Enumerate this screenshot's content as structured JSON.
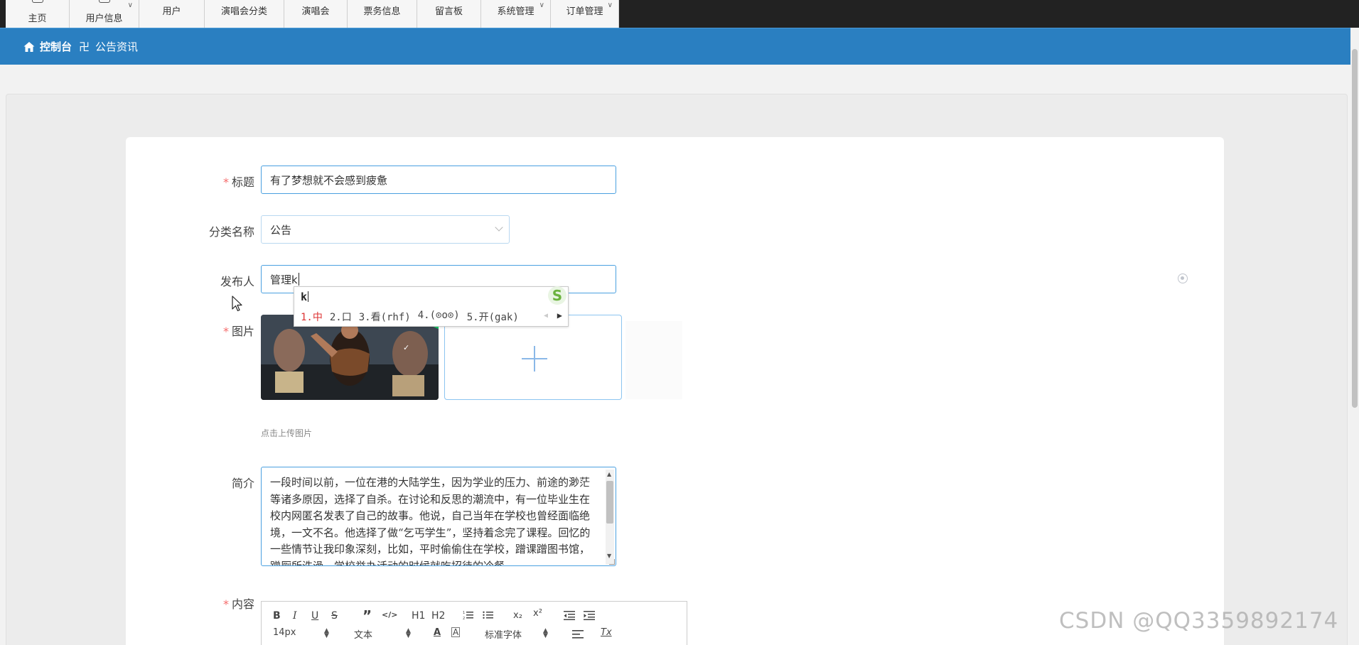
{
  "nav": {
    "tabs": [
      {
        "label": "主页"
      },
      {
        "label": "用户信息"
      },
      {
        "label": "用户"
      },
      {
        "label": "演唱会分类"
      },
      {
        "label": "演唱会"
      },
      {
        "label": "票务信息"
      },
      {
        "label": "留言板"
      },
      {
        "label": "系统管理"
      },
      {
        "label": "订单管理"
      }
    ]
  },
  "breadcrumb": {
    "home": "控制台",
    "separator": "卍",
    "current": "公告资讯"
  },
  "form": {
    "title_label": "标题",
    "title_value": "有了梦想就不会感到疲惫",
    "category_label": "分类名称",
    "category_value": "公告",
    "publisher_label": "发布人",
    "publisher_value": "管理k",
    "image_label": "图片",
    "upload_hint": "点击上传图片",
    "summary_label": "简介",
    "summary_value": "一段时间以前，一位在港的大陆学生，因为学业的压力、前途的渺茫等诸多原因，选择了自杀。在讨论和反思的潮流中，有一位毕业生在校内网匿名发表了自己的故事。他说，自己当年在学校也曾经面临绝境，一文不名。他选择了做“乞丐学生”，坚持着念完了课程。回忆的一些情节让我印象深刻，比如，平时偷偷住在学校，蹭课蹭图书馆，蹭厕所洗澡，学校举办活动的时候就吃招待的冷餐……",
    "content_label": "内容",
    "required_mark": "*"
  },
  "ime": {
    "composition": "k",
    "candidates": [
      "1.中",
      "2.口",
      "3.看(rhf)",
      "4.(⊙o⊙)",
      "5.开(gak)"
    ],
    "logo": "S"
  },
  "editor": {
    "bold": "B",
    "italic": "I",
    "underline": "U",
    "strike": "S",
    "quote": "”",
    "code": "</>",
    "h1": "H1",
    "h2": "H2",
    "subscript": "x₂",
    "superscript": "x²",
    "font_size": "14px",
    "text_style": "文本",
    "font_family": "标准字体",
    "font_color": "A",
    "bg_color": "A",
    "clear_format": "Tx"
  },
  "watermark": "CSDN @QQ3359892174",
  "colors": {
    "nav_bg": "#222222",
    "breadcrumb_bg": "#2a7fc1",
    "input_border": "#4aa0e0",
    "required": "#f56c6c"
  }
}
